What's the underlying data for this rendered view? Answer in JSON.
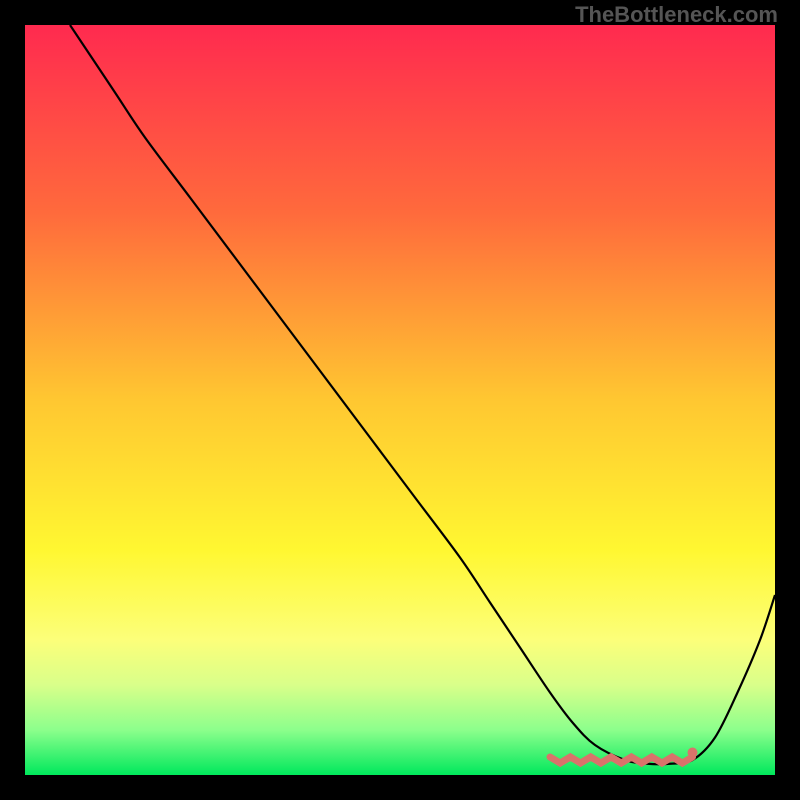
{
  "watermark": "TheBottleneck.com",
  "chart_data": {
    "type": "line",
    "title": "",
    "xlabel": "",
    "ylabel": "",
    "xlim": [
      0,
      100
    ],
    "ylim": [
      0,
      100
    ],
    "gradient_stops": [
      {
        "offset": 0,
        "color": "#ff2a4f"
      },
      {
        "offset": 25,
        "color": "#ff6a3c"
      },
      {
        "offset": 50,
        "color": "#ffc731"
      },
      {
        "offset": 70,
        "color": "#fff731"
      },
      {
        "offset": 82,
        "color": "#fcff7a"
      },
      {
        "offset": 88,
        "color": "#d9ff8a"
      },
      {
        "offset": 94,
        "color": "#8cff8c"
      },
      {
        "offset": 100,
        "color": "#00e85c"
      }
    ],
    "series": [
      {
        "name": "bottleneck-curve",
        "x": [
          6,
          8,
          12,
          16,
          22,
          28,
          34,
          40,
          46,
          52,
          58,
          62,
          66,
          70,
          73,
          76,
          80,
          83,
          86,
          89,
          92,
          95,
          98,
          100
        ],
        "y": [
          100,
          97,
          91,
          85,
          77,
          69,
          61,
          53,
          45,
          37,
          29,
          23,
          17,
          11,
          7,
          4,
          2,
          1.5,
          1.5,
          2,
          5,
          11,
          18,
          24
        ]
      }
    ],
    "flat_region": {
      "x_start": 70,
      "x_end": 89,
      "y": 2,
      "color": "#d9736b"
    },
    "marker": {
      "x": 89,
      "y": 3,
      "color": "#d9736b"
    }
  }
}
